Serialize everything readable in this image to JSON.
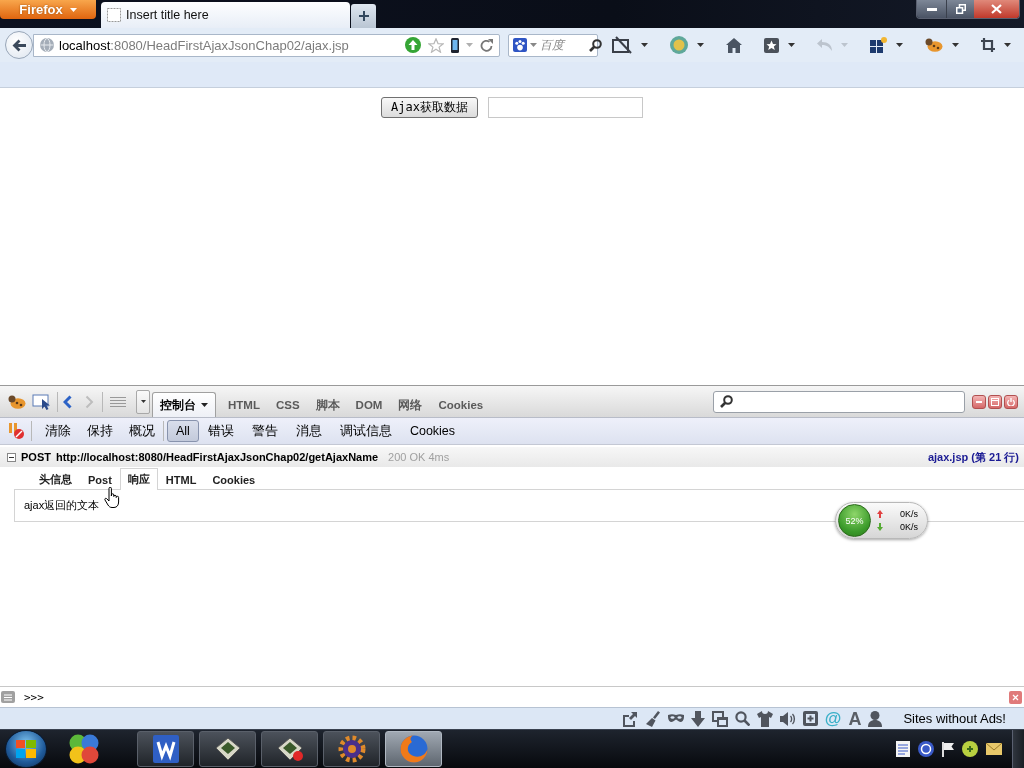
{
  "browser": {
    "menu_button": "Firefox",
    "tabs": [
      {
        "title": "Insert title here",
        "selected": true
      }
    ],
    "address": {
      "host": "localhost",
      "path": ":8080/HeadFirstAjaxJsonChap02/ajax.jsp"
    },
    "search": {
      "placeholder": "百度"
    },
    "toolbar": {
      "undo": {
        "disabled": true
      }
    }
  },
  "page": {
    "fetch_button": "Ajax获取数据"
  },
  "firebug": {
    "forward": {
      "disabled": true
    },
    "panel_tabs": [
      {
        "label": "控制台",
        "selected": true,
        "has_menu": true
      },
      {
        "label": "HTML",
        "selected": false,
        "has_menu": false
      },
      {
        "label": "CSS",
        "selected": false,
        "has_menu": false
      },
      {
        "label": "脚本",
        "selected": false,
        "has_menu": false
      },
      {
        "label": "DOM",
        "selected": false,
        "has_menu": false
      },
      {
        "label": "网络",
        "selected": false,
        "has_menu": false
      },
      {
        "label": "Cookies",
        "selected": false,
        "has_menu": false
      }
    ],
    "console_actions": [
      "清除",
      "保持",
      "概况"
    ],
    "console_filters": [
      {
        "label": "All",
        "selected": true
      },
      {
        "label": "错误",
        "selected": false
      },
      {
        "label": "警告",
        "selected": false
      },
      {
        "label": "消息",
        "selected": false
      },
      {
        "label": "调试信息",
        "selected": false
      },
      {
        "label": "Cookies",
        "selected": false
      }
    ],
    "request": {
      "expanded": true,
      "method": "POST",
      "url": "http://localhost:8080/HeadFirstAjaxJsonChap02/getAjaxName",
      "status": "200 OK 4ms",
      "source": "ajax.jsp (第 21 行)"
    },
    "request_tabs": [
      {
        "label": "头信息",
        "selected": false
      },
      {
        "label": "Post",
        "selected": false
      },
      {
        "label": "响应",
        "selected": true
      },
      {
        "label": "HTML",
        "selected": false
      },
      {
        "label": "Cookies",
        "selected": false
      }
    ],
    "response_text": "ajax返回的文本",
    "command_prompt": ">>>"
  },
  "network_meter": {
    "usage": "52%",
    "upload": "0K/s",
    "download": "0K/s"
  },
  "status_bar": {
    "glyphs": [
      "@",
      "A"
    ],
    "text": "Sites without Ads!"
  },
  "taskbar": {
    "apps": [
      {
        "kind": "writer",
        "selected": false
      },
      {
        "kind": "terminal",
        "selected": false
      },
      {
        "kind": "terminal-alert",
        "selected": false
      },
      {
        "kind": "ide",
        "selected": false
      },
      {
        "kind": "browser",
        "selected": true
      }
    ]
  }
}
